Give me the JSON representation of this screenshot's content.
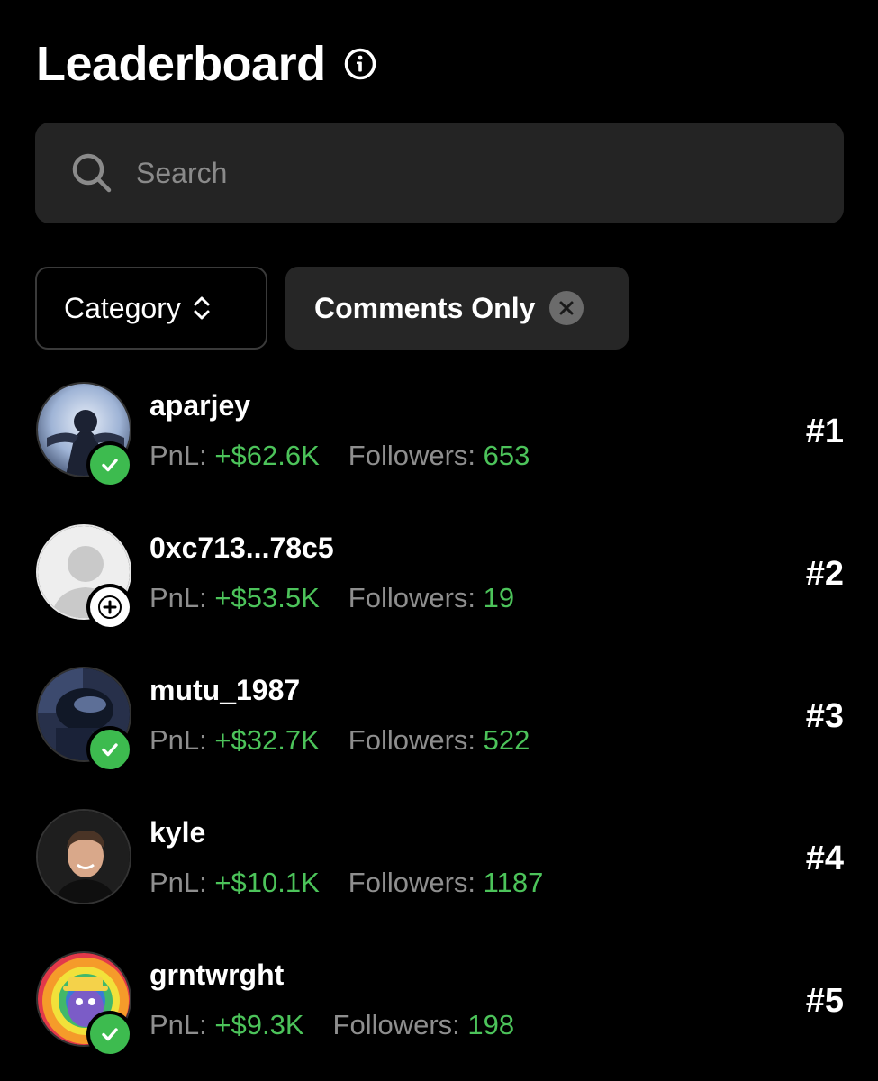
{
  "header": {
    "title": "Leaderboard",
    "info_icon": "info-circle-icon"
  },
  "search": {
    "placeholder": "Search",
    "value": "",
    "icon": "search-icon"
  },
  "filters": {
    "category_label": "Category",
    "chip_label": "Comments Only"
  },
  "labels": {
    "pnl": "PnL:",
    "followers": "Followers:"
  },
  "colors": {
    "accent_green": "#4cc35a",
    "verified_badge": "#3dbb4f",
    "search_bg": "#242424"
  },
  "leaderboard": [
    {
      "username": "aparjey",
      "pnl": "+$62.6K",
      "followers": "653",
      "rank": "#1",
      "badge": "verified"
    },
    {
      "username": "0xc713...78c5",
      "pnl": "+$53.5K",
      "followers": "19",
      "rank": "#2",
      "badge": "follow"
    },
    {
      "username": "mutu_1987",
      "pnl": "+$32.7K",
      "followers": "522",
      "rank": "#3",
      "badge": "verified"
    },
    {
      "username": "kyle",
      "pnl": "+$10.1K",
      "followers": "1187",
      "rank": "#4",
      "badge": "none"
    },
    {
      "username": "grntwrght",
      "pnl": "+$9.3K",
      "followers": "198",
      "rank": "#5",
      "badge": "verified"
    }
  ]
}
